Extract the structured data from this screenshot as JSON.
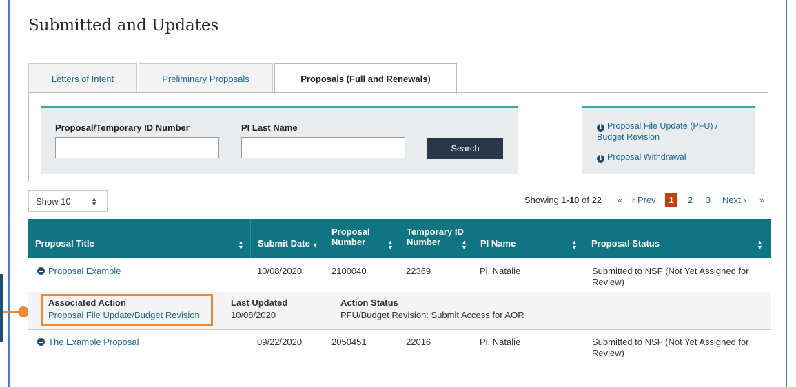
{
  "page": {
    "title": "Submitted and Updates"
  },
  "tabs": [
    {
      "label": "Letters of Intent",
      "active": false
    },
    {
      "label": "Preliminary Proposals",
      "active": false
    },
    {
      "label": "Proposals (Full and Renewals)",
      "active": true
    }
  ],
  "search": {
    "id_label": "Proposal/Temporary ID Number",
    "id_value": "",
    "pi_label": "PI Last Name",
    "pi_value": "",
    "button_label": "Search"
  },
  "info_links": {
    "pfu": "Proposal File Update (PFU) / Budget Revision",
    "withdrawal": "Proposal Withdrawal",
    "icon": "info-icon"
  },
  "show_select": {
    "value": "Show 10"
  },
  "pagination": {
    "showing_prefix": "Showing ",
    "showing_range": "1-10",
    "showing_suffix": " of 22",
    "first": "«",
    "prev": "‹ Prev",
    "pages": [
      "1",
      "2",
      "3"
    ],
    "current": "1",
    "next": "Next ›",
    "last": "»"
  },
  "table": {
    "columns": {
      "title": "Proposal Title",
      "submit_date": "Submit Date",
      "proposal_number_1": "Proposal",
      "proposal_number_2": "Number",
      "temp_id_1": "Temporary ID",
      "temp_id_2": "Number",
      "pi_name": "PI Name",
      "status": "Proposal Status"
    },
    "rows": [
      {
        "title": "Proposal Example",
        "submit_date": "10/08/2020",
        "proposal_number": "2100040",
        "temp_id": "22369",
        "pi_name": "Pi, Natalie",
        "status": "Submitted to NSF (Not Yet Assigned for Review)"
      },
      {
        "title": "The Example Proposal",
        "submit_date": "09/22/2020",
        "proposal_number": "2050451",
        "temp_id": "22016",
        "pi_name": "Pi, Natalie",
        "status": "Submitted to NSF (Not Yet Assigned for Review)"
      }
    ],
    "associated": {
      "action_label": "Associated Action",
      "action_link": "Proposal File Update/Budget Revision",
      "updated_label": "Last Updated",
      "updated_value": "10/08/2020",
      "status_label": "Action Status",
      "status_value": "PFU/Budget Revision: Submit Access for AOR"
    }
  },
  "colors": {
    "table_header": "#117483",
    "link": "#1c6694",
    "highlight": "#f0883a",
    "current_page": "#c14110",
    "search_button": "#283749"
  }
}
